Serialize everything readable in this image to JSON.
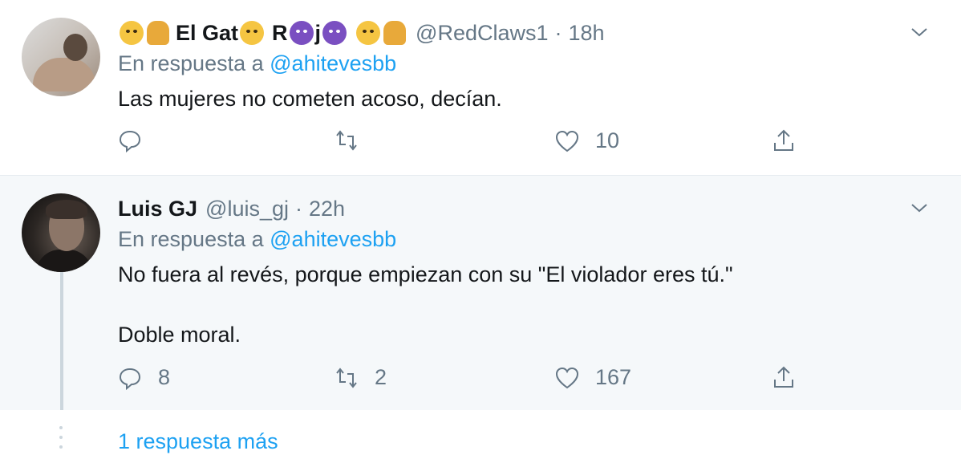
{
  "tweets": [
    {
      "name_parts": [
        "El Gat",
        "R",
        "j"
      ],
      "handle": "@RedClaws1",
      "time": "18h",
      "reply_prefix": "En respuesta a",
      "reply_handle": "@ahitevesbb",
      "lines": [
        "Las mujeres no cometen acoso, decían."
      ],
      "reply_count": "",
      "retweet_count": "",
      "like_count": "10"
    },
    {
      "name": "Luis GJ",
      "handle": "@luis_gj",
      "time": "22h",
      "reply_prefix": "En respuesta a",
      "reply_handle": "@ahitevesbb",
      "lines": [
        "No fuera al revés, porque empiezan con su \"El violador eres tú.\"",
        "Doble moral."
      ],
      "reply_count": "8",
      "retweet_count": "2",
      "like_count": "167"
    }
  ],
  "more_replies": "1 respuesta más",
  "icons": {
    "reply": "reply-icon",
    "retweet": "retweet-icon",
    "like": "heart-icon",
    "share": "share-icon",
    "menu": "chevron-down-icon"
  },
  "colors": {
    "link": "#1da1f2",
    "muted": "#657786",
    "text": "#14171a",
    "highlight_bg": "#f5f8fa"
  }
}
